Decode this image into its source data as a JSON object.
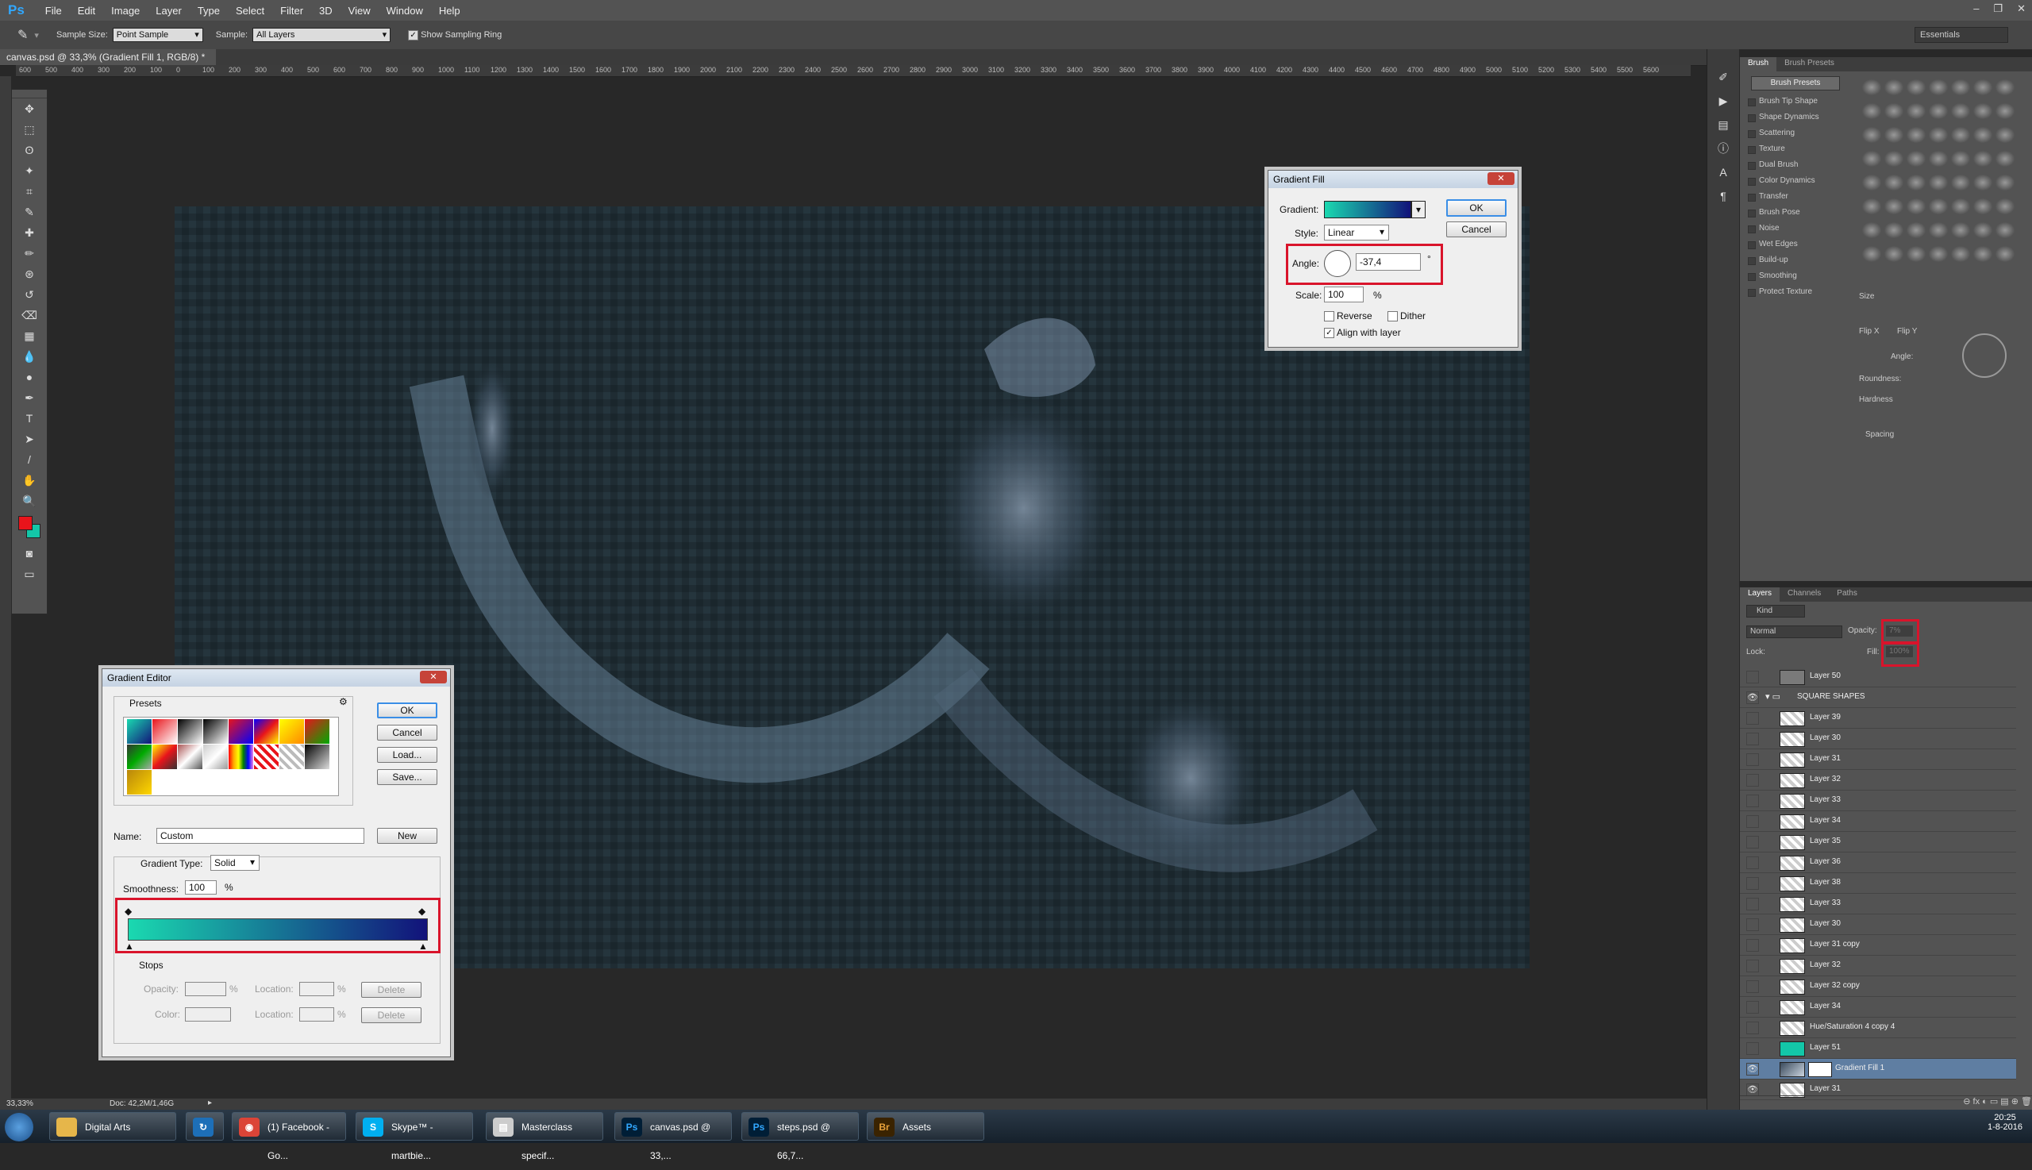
{
  "app": {
    "logo": "Ps"
  },
  "menu": [
    "File",
    "Edit",
    "Image",
    "Layer",
    "Type",
    "Select",
    "Filter",
    "3D",
    "View",
    "Window",
    "Help"
  ],
  "window_controls": [
    "–",
    "❐",
    "✕"
  ],
  "options_bar": {
    "sample_size_label": "Sample Size:",
    "sample_size_value": "Point Sample",
    "sample_label": "Sample:",
    "sample_value": "All Layers",
    "show_ring_label": "Show Sampling Ring",
    "workspace": "Essentials"
  },
  "document_tab": "canvas.psd @ 33,3% (Gradient Fill 1, RGB/8) *",
  "ruler_labels": [
    "600",
    "500",
    "400",
    "300",
    "200",
    "100",
    "0",
    "100",
    "200",
    "300",
    "400",
    "500",
    "600",
    "700",
    "800",
    "900",
    "1000",
    "1100",
    "1200",
    "1300",
    "1400",
    "1500",
    "1600",
    "1700",
    "1800",
    "1900",
    "2000",
    "2100",
    "2200",
    "2300",
    "2400",
    "2500",
    "2600",
    "2700",
    "2800",
    "2900",
    "3000",
    "3100",
    "3200",
    "3300",
    "3400",
    "3500",
    "3600",
    "3700",
    "3800",
    "3900",
    "4000",
    "4100",
    "4200",
    "4300",
    "4400",
    "4500",
    "4600",
    "4700",
    "4800",
    "4900",
    "5000",
    "5100",
    "5200",
    "5300",
    "5400",
    "5500",
    "5600"
  ],
  "status": {
    "zoom": "33,33%",
    "doc": "Doc: 42,2M/1,46G"
  },
  "tool_icons": [
    "move-tool",
    "marquee-tool",
    "lasso-tool",
    "quick-select-tool",
    "crop-tool",
    "eyedropper-tool",
    "healing-tool",
    "brush-tool",
    "stamp-tool",
    "history-brush-tool",
    "eraser-tool",
    "gradient-tool",
    "blur-tool",
    "dodge-tool",
    "pen-tool",
    "type-tool",
    "path-select-tool",
    "line-tool",
    "hand-tool",
    "zoom-tool"
  ],
  "colors": {
    "foreground": "#e8141b",
    "background": "#13c7a8",
    "accent_red": "#d9142b",
    "gradient_start": "#1ad9b0",
    "gradient_end": "#12127a"
  },
  "brush_panel": {
    "tabs": [
      "Brush",
      "Brush Presets"
    ],
    "presets_button": "Brush Presets",
    "options": [
      "Brush Tip Shape",
      "Shape Dynamics",
      "Scattering",
      "Texture",
      "Dual Brush",
      "Color Dynamics",
      "Transfer",
      "Brush Pose",
      "Noise",
      "Wet Edges",
      "Build-up",
      "Smoothing",
      "Protect Texture"
    ],
    "size_label": "Size",
    "flip_x": "Flip X",
    "flip_y": "Flip Y",
    "angle_label": "Angle:",
    "roundness_label": "Roundness:",
    "hardness_label": "Hardness",
    "spacing_label": "Spacing"
  },
  "layers_panel": {
    "tabs": [
      "Layers",
      "Channels",
      "Paths"
    ],
    "kind": "Kind",
    "blend_mode": "Normal",
    "opacity_label": "Opacity:",
    "opacity_value": "7%",
    "lock_label": "Lock:",
    "fill_label": "Fill:",
    "fill_value": "100%",
    "layers": [
      {
        "name": "Layer 50",
        "eye": false,
        "type": "plain"
      },
      {
        "name": "SQUARE SHAPES",
        "eye": true,
        "type": "group"
      },
      {
        "name": "Layer 39",
        "eye": false,
        "type": "plain"
      },
      {
        "name": "Layer 30",
        "eye": false,
        "type": "plain"
      },
      {
        "name": "Layer 31",
        "eye": false,
        "type": "plain"
      },
      {
        "name": "Layer 32",
        "eye": false,
        "type": "plain"
      },
      {
        "name": "Layer 33",
        "eye": false,
        "type": "plain"
      },
      {
        "name": "Layer 34",
        "eye": false,
        "type": "plain"
      },
      {
        "name": "Layer 35",
        "eye": false,
        "type": "plain"
      },
      {
        "name": "Layer 36",
        "eye": false,
        "type": "plain"
      },
      {
        "name": "Layer 38",
        "eye": false,
        "type": "plain"
      },
      {
        "name": "Layer 33",
        "eye": false,
        "type": "plain"
      },
      {
        "name": "Layer 30",
        "eye": false,
        "type": "plain"
      },
      {
        "name": "Layer 31 copy",
        "eye": false,
        "type": "plain"
      },
      {
        "name": "Layer 32",
        "eye": false,
        "type": "plain"
      },
      {
        "name": "Layer 32 copy",
        "eye": false,
        "type": "plain"
      },
      {
        "name": "Layer 34",
        "eye": false,
        "type": "plain"
      },
      {
        "name": "Hue/Saturation 4 copy 4",
        "eye": false,
        "type": "plain"
      },
      {
        "name": "Layer 51",
        "eye": false,
        "type": "teal"
      },
      {
        "name": "Gradient Fill 1",
        "eye": true,
        "type": "selected"
      },
      {
        "name": "Layer 31",
        "eye": true,
        "type": "plain"
      }
    ]
  },
  "gradient_fill_dialog": {
    "title": "Gradient Fill",
    "gradient_label": "Gradient:",
    "style_label": "Style:",
    "style_value": "Linear",
    "angle_label": "Angle:",
    "angle_value": "-37,4",
    "degree": "°",
    "scale_label": "Scale:",
    "scale_value": "100",
    "percent": "%",
    "reverse": "Reverse",
    "dither": "Dither",
    "align": "Align with layer",
    "ok": "OK",
    "cancel": "Cancel"
  },
  "gradient_editor": {
    "title": "Gradient Editor",
    "presets_label": "Presets",
    "ok": "OK",
    "cancel": "Cancel",
    "load": "Load...",
    "save": "Save...",
    "name_label": "Name:",
    "name_value": "Custom",
    "new": "New",
    "type_label": "Gradient Type:",
    "type_value": "Solid",
    "smoothness_label": "Smoothness:",
    "smoothness_value": "100",
    "percent": "%",
    "stops_label": "Stops",
    "opacity_label": "Opacity:",
    "location_label": "Location:",
    "color_label": "Color:",
    "delete": "Delete"
  },
  "taskbar": [
    {
      "label": "Digital Arts",
      "icon": "folder-icon"
    },
    {
      "label": "",
      "icon": "refresh-icon"
    },
    {
      "label": "(1) Facebook - Go...",
      "icon": "chrome-icon"
    },
    {
      "label": "Skype™ - martbie...",
      "icon": "skype-icon"
    },
    {
      "label": "Masterclass specif...",
      "icon": "document-icon"
    },
    {
      "label": "canvas.psd @ 33,...",
      "icon": "photoshop-icon"
    },
    {
      "label": "steps.psd @ 66,7...",
      "icon": "photoshop-icon"
    },
    {
      "label": "Assets",
      "icon": "bridge-icon"
    }
  ],
  "clock": {
    "time": "20:25",
    "date": "1-8-2016"
  }
}
